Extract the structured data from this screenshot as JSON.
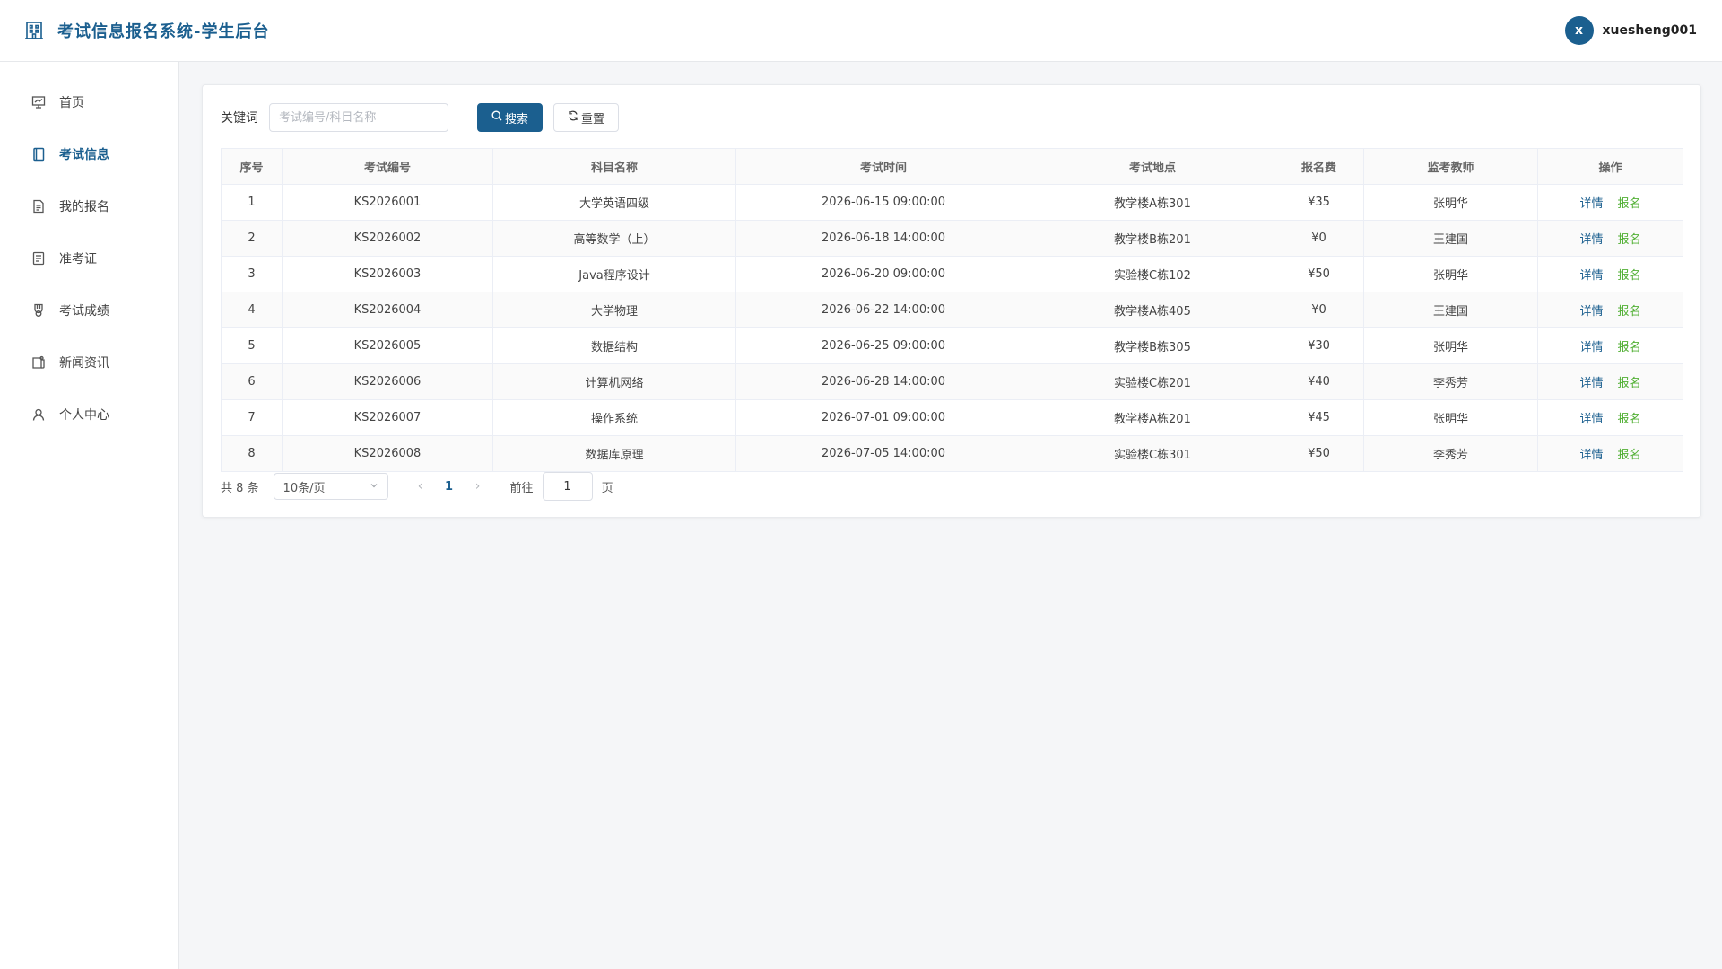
{
  "header": {
    "title": "考试信息报名系统-学生后台",
    "avatar_letter": "x",
    "username": "xuesheng001",
    "brand_icon": "building-icon"
  },
  "sidebar": {
    "items": [
      {
        "label": "首页",
        "icon": "presentation-icon",
        "active": false
      },
      {
        "label": "考试信息",
        "icon": "book-icon",
        "active": true
      },
      {
        "label": "我的报名",
        "icon": "document-icon",
        "active": false
      },
      {
        "label": "准考证",
        "icon": "ticket-icon",
        "active": false
      },
      {
        "label": "考试成绩",
        "icon": "medal-icon",
        "active": false
      },
      {
        "label": "新闻资讯",
        "icon": "news-icon",
        "active": false
      },
      {
        "label": "个人中心",
        "icon": "user-icon",
        "active": false
      }
    ]
  },
  "search": {
    "label": "关键词",
    "placeholder": "考试编号/科目名称",
    "search_button": "搜索",
    "reset_button": "重置"
  },
  "table": {
    "columns": [
      "序号",
      "考试编号",
      "科目名称",
      "考试时间",
      "考试地点",
      "报名费",
      "监考教师",
      "操作"
    ],
    "rows": [
      {
        "no": "1",
        "code": "KS2026001",
        "subject": "大学英语四级",
        "time": "2026-06-15 09:00:00",
        "place": "教学楼A栋301",
        "fee": "¥35",
        "teacher": "张明华"
      },
      {
        "no": "2",
        "code": "KS2026002",
        "subject": "高等数学（上）",
        "time": "2026-06-18 14:00:00",
        "place": "教学楼B栋201",
        "fee": "¥0",
        "teacher": "王建国"
      },
      {
        "no": "3",
        "code": "KS2026003",
        "subject": "Java程序设计",
        "time": "2026-06-20 09:00:00",
        "place": "实验楼C栋102",
        "fee": "¥50",
        "teacher": "张明华"
      },
      {
        "no": "4",
        "code": "KS2026004",
        "subject": "大学物理",
        "time": "2026-06-22 14:00:00",
        "place": "教学楼A栋405",
        "fee": "¥0",
        "teacher": "王建国"
      },
      {
        "no": "5",
        "code": "KS2026005",
        "subject": "数据结构",
        "time": "2026-06-25 09:00:00",
        "place": "教学楼B栋305",
        "fee": "¥30",
        "teacher": "张明华"
      },
      {
        "no": "6",
        "code": "KS2026006",
        "subject": "计算机网络",
        "time": "2026-06-28 14:00:00",
        "place": "实验楼C栋201",
        "fee": "¥40",
        "teacher": "李秀芳"
      },
      {
        "no": "7",
        "code": "KS2026007",
        "subject": "操作系统",
        "time": "2026-07-01 09:00:00",
        "place": "教学楼A栋201",
        "fee": "¥45",
        "teacher": "张明华"
      },
      {
        "no": "8",
        "code": "KS2026008",
        "subject": "数据库原理",
        "time": "2026-07-05 14:00:00",
        "place": "实验楼C栋301",
        "fee": "¥50",
        "teacher": "李秀芳"
      }
    ],
    "detail_label": "详情",
    "signup_label": "报名"
  },
  "pager": {
    "total": "共 8 条",
    "page_size": "10条/页",
    "current_page": "1",
    "goto_label": "前往",
    "goto_value": "1",
    "page_suffix": "页"
  },
  "colors": {
    "primary": "#1b5f8f",
    "success": "#52b035"
  }
}
